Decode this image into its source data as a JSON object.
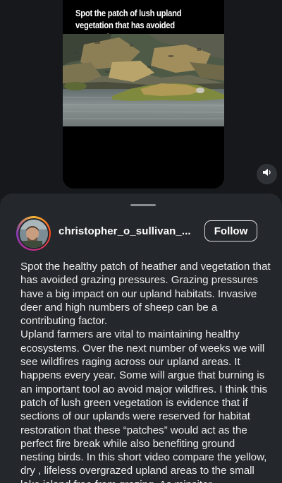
{
  "video": {
    "caption": "Spot the patch of lush upland vegetation that has avoided overgrazing"
  },
  "icons": {
    "sound": "speaker-icon",
    "handle": "drag-handle"
  },
  "post": {
    "username": "christopher_o_sullivan_...",
    "follow_label": "Follow",
    "caption": "Spot the healthy patch of heather and vegetation that has avoided grazing pressures. Grazing pressures have a big impact on our upland habitats. Invasive deer and high numbers of sheep can be a contributing factor.\nUpland farmers are vital to maintaining healthy ecosystems. Over the next number of weeks we will see wildfires raging across our upland areas. It happens every year. Some will argue that burning is an important tool ao avoid major wildfires. I think this patch of lush green vegetation is evidence that if sections of our uplands were reserved for habitat restoration that these “patches” would act as the perfect fire break while also benefiting ground nesting birds. In this short video compare the yellow, dry , lifeless overgrazed upland areas to the small lake island free from grazing. As minsiter"
  },
  "colors": {
    "background": "#191b1e",
    "sheet": "#24272b",
    "text": "#ececec",
    "follow_border": "#d9dadc"
  }
}
